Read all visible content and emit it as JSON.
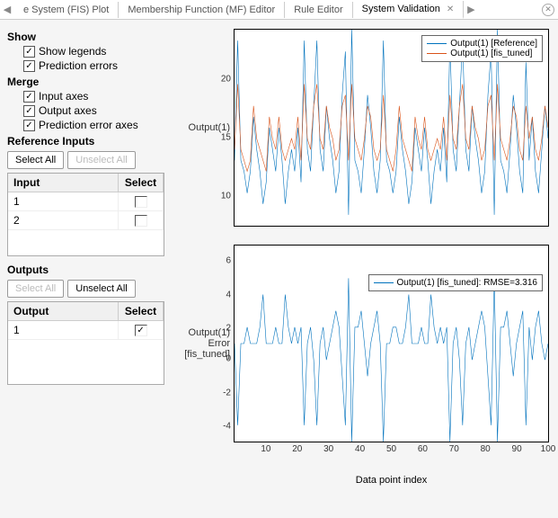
{
  "tabs": {
    "t0": "e System (FIS) Plot",
    "t1": "Membership Function (MF) Editor",
    "t2": "Rule Editor",
    "t3": "System Validation"
  },
  "sidebar": {
    "show_head": "Show",
    "show_legends": "Show legends",
    "pred_errors": "Prediction errors",
    "merge_head": "Merge",
    "input_axes": "Input axes",
    "output_axes": "Output axes",
    "pred_err_axes": "Prediction error axes",
    "ref_inputs_head": "Reference Inputs",
    "select_all": "Select All",
    "unselect_all": "Unselect All",
    "input_col": "Input",
    "select_col": "Select",
    "output_col": "Output",
    "inputs": {
      "r0": "1",
      "r1": "2"
    },
    "outputs_head": "Outputs",
    "outputs": {
      "r0": "1"
    }
  },
  "chart1": {
    "ylabel": "Output(1)",
    "legend_ref": "Output(1) [Reference]",
    "legend_tuned": "Output(1) [fis_tuned]",
    "yticks": {
      "t0": "10",
      "t1": "15",
      "t2": "20"
    }
  },
  "chart2": {
    "ylabel": "Output(1) Error [fis_tuned]",
    "legend": "Output(1) [fis_tuned]: RMSE=3.316",
    "yticks": {
      "t0": "-4",
      "t1": "-2",
      "t2": "0",
      "t3": "2",
      "t4": "4",
      "t5": "6"
    },
    "xlabel": "Data point index",
    "xticks": {
      "t0": "10",
      "t1": "20",
      "t2": "30",
      "t3": "40",
      "t4": "50",
      "t5": "60",
      "t6": "70",
      "t7": "80",
      "t8": "90",
      "t9": "100"
    }
  },
  "colors": {
    "blue": "#0072BD",
    "orange": "#D95319"
  },
  "chart_data": [
    {
      "type": "line",
      "title": "Output(1)",
      "xlabel": "",
      "ylabel": "Output(1)",
      "xlim": [
        1,
        100
      ],
      "ylim": [
        7,
        25
      ],
      "series": [
        {
          "name": "Output(1) [Reference]",
          "color": "#0072BD",
          "values": [
            13,
            24,
            13,
            12,
            10,
            12,
            17,
            14,
            12,
            9,
            11,
            16,
            14,
            12,
            16,
            13,
            9,
            12,
            14,
            12,
            16,
            11,
            24,
            14,
            12,
            18,
            24,
            14,
            12,
            18,
            15,
            13,
            10,
            12,
            19,
            23,
            8,
            25,
            13,
            12,
            10,
            14,
            19,
            16,
            12,
            10,
            13,
            24,
            13,
            12,
            10,
            12,
            17,
            14,
            12,
            9,
            11,
            16,
            14,
            12,
            16,
            13,
            9,
            12,
            14,
            12,
            16,
            11,
            24,
            14,
            12,
            18,
            24,
            14,
            12,
            18,
            15,
            13,
            10,
            12,
            19,
            23,
            8,
            25,
            13,
            12,
            10,
            14,
            19,
            16,
            12,
            10,
            22,
            13,
            17,
            12,
            10,
            14,
            18,
            15
          ]
        },
        {
          "name": "Output(1) [fis_tuned]",
          "color": "#D95319",
          "values": [
            14,
            20,
            14,
            13,
            12,
            13,
            18,
            15,
            14,
            13,
            12,
            17,
            15,
            14,
            17,
            14,
            13,
            14,
            15,
            14,
            17,
            13,
            20,
            15,
            14,
            18,
            20,
            15,
            14,
            18,
            16,
            15,
            13,
            14,
            18,
            19,
            13,
            20,
            15,
            14,
            13,
            15,
            18,
            17,
            14,
            13,
            14,
            19,
            14,
            13,
            12,
            14,
            18,
            15,
            14,
            13,
            12,
            17,
            15,
            14,
            17,
            14,
            13,
            14,
            15,
            14,
            17,
            13,
            19,
            15,
            14,
            18,
            20,
            15,
            14,
            18,
            16,
            15,
            13,
            14,
            18,
            19,
            13,
            20,
            15,
            14,
            13,
            15,
            18,
            17,
            14,
            13,
            18,
            15,
            17,
            14,
            13,
            15,
            18,
            16
          ]
        }
      ]
    },
    {
      "type": "line",
      "title": "Output(1) Error [fis_tuned]",
      "xlabel": "Data point index",
      "ylabel": "Output(1) Error [fis_tuned]",
      "xlim": [
        1,
        100
      ],
      "ylim": [
        -5,
        7
      ],
      "annotation": "RMSE=3.316",
      "series": [
        {
          "name": "Output(1) [fis_tuned]: RMSE=3.316",
          "color": "#0072BD",
          "values": [
            1,
            -4,
            1,
            1,
            2,
            1,
            1,
            1,
            2,
            4,
            1,
            1,
            1,
            2,
            1,
            1,
            4,
            2,
            1,
            2,
            1,
            2,
            -4,
            1,
            2,
            0,
            -4,
            1,
            2,
            0,
            1,
            2,
            3,
            2,
            -1,
            -4,
            5,
            -5,
            2,
            2,
            3,
            1,
            -1,
            1,
            2,
            3,
            1,
            -5,
            1,
            1,
            2,
            2,
            1,
            1,
            2,
            4,
            1,
            1,
            1,
            2,
            1,
            1,
            4,
            2,
            1,
            2,
            1,
            2,
            -5,
            1,
            2,
            0,
            -4,
            1,
            2,
            0,
            1,
            2,
            3,
            2,
            -1,
            -4,
            5,
            -5,
            2,
            2,
            3,
            1,
            -1,
            1,
            2,
            3,
            -4,
            2,
            0,
            2,
            3,
            1,
            0,
            1
          ]
        }
      ]
    }
  ]
}
